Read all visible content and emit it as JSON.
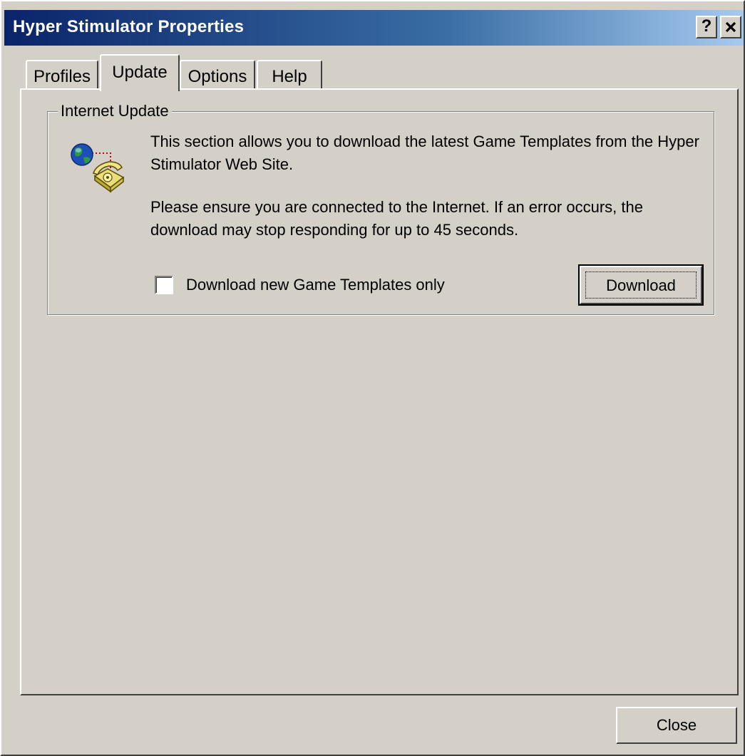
{
  "window": {
    "title": "Hyper Stimulator Properties",
    "help_button": "?",
    "close_button": "✕"
  },
  "tabs": [
    {
      "label": "Profiles",
      "active": false
    },
    {
      "label": "Update",
      "active": true
    },
    {
      "label": "Options",
      "active": false
    },
    {
      "label": "Help",
      "active": false
    }
  ],
  "internet_update": {
    "group_label": "Internet Update",
    "icon": "globe-phone-icon",
    "description_1": "This section allows you to download the latest Game Templates from the Hyper Stimulator Web Site.",
    "description_2": "Please ensure you are connected to the Internet. If an error occurs, the download may stop responding for up to 45 seconds.",
    "checkbox_label": "Download new Game Templates only",
    "checkbox_checked": false,
    "download_button": "Download"
  },
  "footer": {
    "close_button": "Close"
  },
  "colors": {
    "face": "#d4d0c8",
    "title_start": "#0a246a",
    "title_end": "#a6caf0"
  }
}
